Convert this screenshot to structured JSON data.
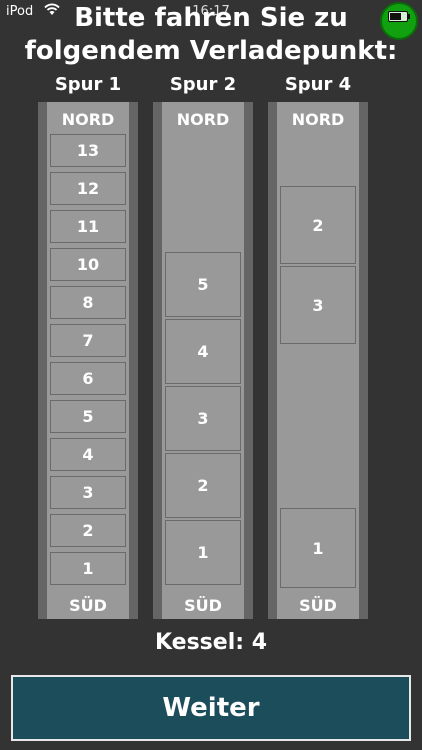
{
  "status_bar": {
    "device": "iPod",
    "time": "16:17"
  },
  "title": {
    "line1": "Bitte fahren Sie zu",
    "line2": "folgendem Verladepunkt:"
  },
  "lanes": [
    {
      "label": "Spur 1",
      "north": "NORD",
      "south": "SÜD",
      "slots": [
        "13",
        "12",
        "11",
        "10",
        "8",
        "7",
        "6",
        "5",
        "4",
        "3",
        "2",
        "1"
      ]
    },
    {
      "label": "Spur 2",
      "north": "NORD",
      "south": "SÜD",
      "slots": [
        "5",
        "4",
        "3",
        "2",
        "1"
      ]
    },
    {
      "label": "Spur 4",
      "north": "NORD",
      "south": "SÜD",
      "slots": [
        "2",
        "3",
        "1"
      ]
    }
  ],
  "kessel": "Kessel: 4",
  "button": {
    "label": "Weiter"
  },
  "colors": {
    "background": "#333333",
    "lane_outer": "#656565",
    "lane_inner": "#999999",
    "button": "#1c4d5a",
    "status_indicator": "#10a010"
  }
}
